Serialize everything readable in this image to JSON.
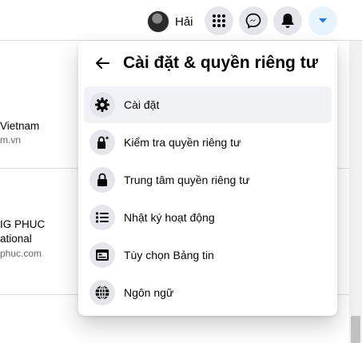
{
  "topbar": {
    "profile_name": "Hải",
    "buttons": [
      {
        "name": "menu-grid",
        "icon": "grid-icon"
      },
      {
        "name": "messenger",
        "icon": "messenger-icon"
      },
      {
        "name": "notifications",
        "icon": "bell-icon"
      },
      {
        "name": "account",
        "icon": "caret-down-icon",
        "active": true
      }
    ]
  },
  "feed": {
    "items": [
      {
        "title": "Vietnam",
        "subtitle": "m.vn"
      },
      {
        "title_line1": "IG PHUC",
        "title_line2": "ational",
        "subtitle": "phuc.com"
      }
    ]
  },
  "panel": {
    "title": "Cài đặt & quyền riêng tư",
    "items": [
      {
        "label": "Cài đặt",
        "icon": "gear-icon"
      },
      {
        "label": "Kiểm tra quyền riêng tư",
        "icon": "lock-sparkle-icon"
      },
      {
        "label": "Trung tâm quyền riêng tư",
        "icon": "lock-icon"
      },
      {
        "label": "Nhật ký hoạt động",
        "icon": "list-icon"
      },
      {
        "label": "Tùy chọn Bảng tin",
        "icon": "news-feed-icon"
      },
      {
        "label": "Ngôn ngữ",
        "icon": "globe-icon"
      }
    ]
  },
  "colors": {
    "accent": "#1877f2",
    "text": "#050505",
    "secondary_text": "#65676b",
    "icon_bg": "#e4e6eb"
  }
}
